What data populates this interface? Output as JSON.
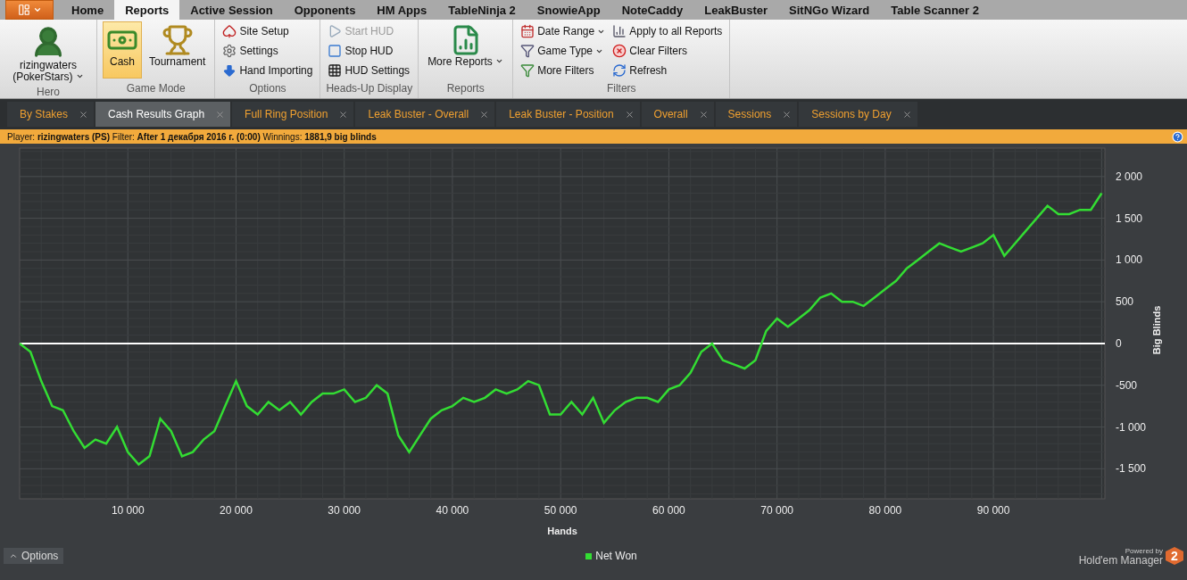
{
  "menu_tabs": [
    {
      "label": "Home",
      "selected": false
    },
    {
      "label": "Reports",
      "selected": true
    },
    {
      "label": "Active Session",
      "selected": false
    },
    {
      "label": "Opponents",
      "selected": false
    },
    {
      "label": "HM Apps",
      "selected": false
    },
    {
      "label": "TableNinja 2",
      "selected": false
    },
    {
      "label": "SnowieApp",
      "selected": false
    },
    {
      "label": "NoteCaddy",
      "selected": false
    },
    {
      "label": "LeakBuster",
      "selected": false
    },
    {
      "label": "SitNGo Wizard",
      "selected": false
    },
    {
      "label": "Table Scanner 2",
      "selected": false
    }
  ],
  "ribbon_groups": [
    {
      "label": "Hero",
      "items": [
        {
          "label": "rizingwaters (PokerStars)",
          "kind": "large",
          "dropdown": true
        }
      ]
    },
    {
      "label": "Game Mode",
      "items": [
        {
          "label": "Cash",
          "kind": "large",
          "dropdown": false,
          "selected": true
        },
        {
          "label": "Tournament",
          "kind": "large",
          "dropdown": false,
          "selected": false
        }
      ]
    },
    {
      "label": "Options",
      "items": [
        {
          "label": "Site Setup",
          "kind": "small",
          "dropdown": false
        },
        {
          "label": "Settings",
          "kind": "small",
          "dropdown": false
        },
        {
          "label": "Hand Importing",
          "kind": "small",
          "dropdown": false
        }
      ]
    },
    {
      "label": "Heads-Up Display",
      "items": [
        {
          "label": "Start HUD",
          "kind": "small",
          "dropdown": false,
          "disabled": true
        },
        {
          "label": "Stop HUD",
          "kind": "small",
          "dropdown": false,
          "disabled": false
        },
        {
          "label": "HUD Settings",
          "kind": "small",
          "dropdown": false,
          "disabled": false
        }
      ]
    },
    {
      "label": "Reports",
      "items": [
        {
          "label": "More Reports",
          "kind": "large",
          "dropdown": true
        }
      ]
    },
    {
      "label": "Filters",
      "items": [
        {
          "label": "Date Range",
          "kind": "small",
          "dropdown": true
        },
        {
          "label": "Game Type",
          "kind": "small",
          "dropdown": true
        },
        {
          "label": "More Filters",
          "kind": "small",
          "dropdown": false
        },
        {
          "label": "Apply to all Reports",
          "kind": "small",
          "dropdown": false
        },
        {
          "label": "Clear Filters",
          "kind": "small",
          "dropdown": false
        },
        {
          "label": "Refresh",
          "kind": "small",
          "dropdown": false
        }
      ]
    }
  ],
  "report_tabs": [
    {
      "label": "By Stakes",
      "selected": false
    },
    {
      "label": "Cash Results Graph",
      "selected": true
    },
    {
      "label": "Full Ring Position",
      "selected": false
    },
    {
      "label": "Leak Buster - Overall",
      "selected": false
    },
    {
      "label": "Leak Buster - Position",
      "selected": false
    },
    {
      "label": "Overall",
      "selected": false
    },
    {
      "label": "Sessions",
      "selected": false
    },
    {
      "label": "Sessions by Day",
      "selected": false
    }
  ],
  "filter_bar": {
    "text": "Player: **rizingwaters (PS)** Filter: **After 1 декабря 2016 г. (0:00)** Winnings: **1881,9 big blinds**"
  },
  "chart_data": {
    "type": "line",
    "xlabel": "Hands",
    "ylabel": "Big Blinds",
    "xlim": [
      0,
      100300
    ],
    "ylim": [
      -1860,
      2340
    ],
    "xticks": [
      {
        "value": 10000,
        "label": "10 000"
      },
      {
        "value": 20000,
        "label": "20 000"
      },
      {
        "value": 30000,
        "label": "30 000"
      },
      {
        "value": 40000,
        "label": "40 000"
      },
      {
        "value": 50000,
        "label": "50 000"
      },
      {
        "value": 60000,
        "label": "60 000"
      },
      {
        "value": 70000,
        "label": "70 000"
      },
      {
        "value": 80000,
        "label": "80 000"
      },
      {
        "value": 90000,
        "label": "90 000"
      }
    ],
    "yticks": [
      {
        "value": 2000,
        "label": "2 000"
      },
      {
        "value": 1500,
        "label": "1 500"
      },
      {
        "value": 1000,
        "label": "1 000"
      },
      {
        "value": 500,
        "label": "500"
      },
      {
        "value": 0,
        "label": "0"
      },
      {
        "value": -500,
        "label": "-500"
      },
      {
        "value": -1000,
        "label": "-1 000"
      },
      {
        "value": -1500,
        "label": "-1 500"
      }
    ],
    "x": [
      0,
      1000,
      2000,
      3000,
      4000,
      5000,
      6000,
      7000,
      8000,
      9000,
      10000,
      11000,
      12000,
      13000,
      14000,
      15000,
      16000,
      17000,
      18000,
      19000,
      20000,
      21000,
      22000,
      23000,
      24000,
      25000,
      26000,
      27000,
      28000,
      29000,
      30000,
      31000,
      32000,
      33000,
      34000,
      35000,
      36000,
      37000,
      38000,
      39000,
      40000,
      41000,
      42000,
      43000,
      44000,
      45000,
      46000,
      47000,
      48000,
      49000,
      50000,
      51000,
      52000,
      53000,
      54000,
      55000,
      56000,
      57000,
      58000,
      59000,
      60000,
      61000,
      62000,
      63000,
      64000,
      65000,
      66000,
      67000,
      68000,
      69000,
      70000,
      71000,
      72000,
      73000,
      74000,
      75000,
      76000,
      77000,
      78000,
      79000,
      80000,
      81000,
      82000,
      83000,
      84000,
      85000,
      86000,
      87000,
      88000,
      89000,
      90000,
      91000,
      92000,
      93000,
      94000,
      95000,
      96000,
      97000,
      98000,
      99000,
      100000
    ],
    "series": [
      {
        "name": "Net Won",
        "color": "#33dd33",
        "values": [
          0,
          -100,
          -450,
          -750,
          -800,
          -1050,
          -1250,
          -1150,
          -1200,
          -1000,
          -1300,
          -1450,
          -1350,
          -900,
          -1050,
          -1350,
          -1300,
          -1150,
          -1050,
          -750,
          -450,
          -750,
          -850,
          -700,
          -800,
          -700,
          -850,
          -700,
          -600,
          -600,
          -550,
          -700,
          -650,
          -500,
          -600,
          -1100,
          -1300,
          -1100,
          -900,
          -800,
          -750,
          -650,
          -700,
          -650,
          -550,
          -600,
          -550,
          -450,
          -500,
          -850,
          -850,
          -700,
          -850,
          -650,
          -950,
          -800,
          -700,
          -650,
          -650,
          -700,
          -550,
          -500,
          -350,
          -100,
          0,
          -200,
          -250,
          -300,
          -200,
          150,
          300,
          200,
          300,
          400,
          550,
          600,
          500,
          500,
          450,
          550,
          650,
          750,
          900,
          1000,
          1100,
          1200,
          1150,
          1100,
          1150,
          1200,
          1300,
          1050,
          1200,
          1350,
          1500,
          1650,
          1550,
          1550,
          1600,
          1600,
          1800
        ]
      }
    ],
    "grid": true
  },
  "options_button": {
    "label": "Options"
  },
  "branding": {
    "powered_by": "Powered by",
    "product": "Hold'em Manager",
    "badge": "2"
  }
}
